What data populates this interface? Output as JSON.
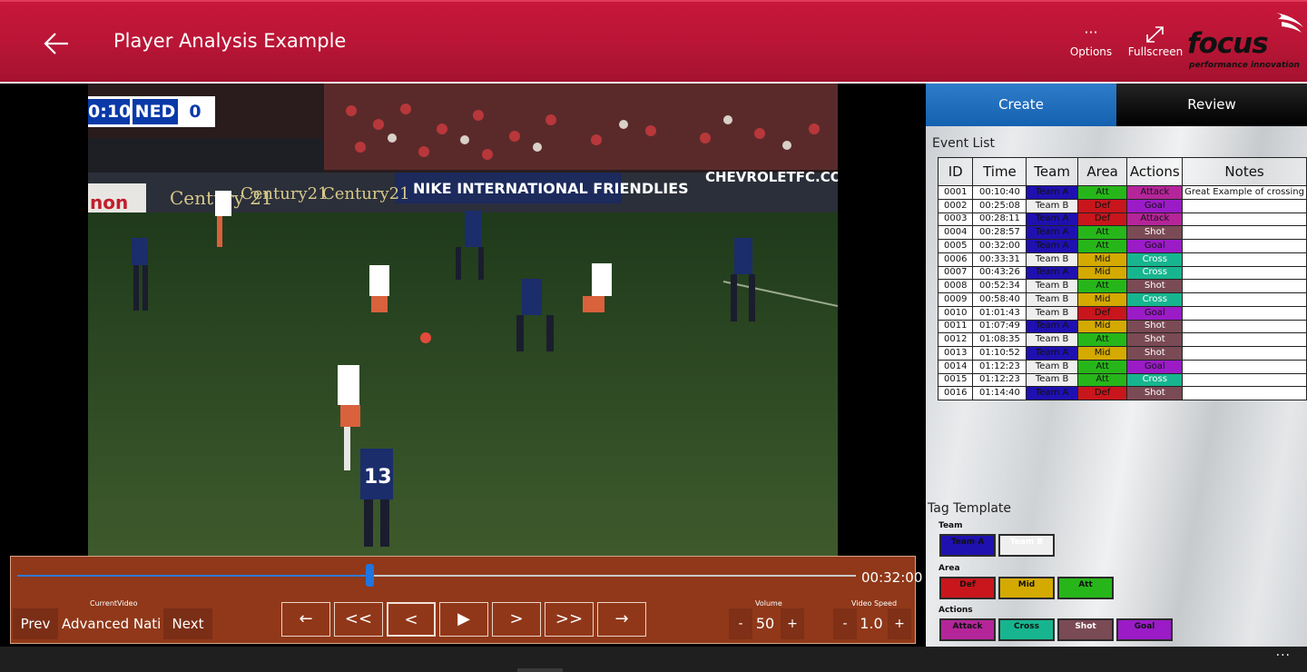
{
  "header": {
    "title": "Player Analysis Example",
    "back_icon": "back-arrow-icon",
    "options_label": "Options",
    "fullscreen_label": "Fullscreen",
    "logo_name": "focus",
    "logo_tagline": "performance innovation",
    "brand_color": "#b81535"
  },
  "video": {
    "scoreboard": {
      "clock": "0:10",
      "team": "NED",
      "score": "0"
    },
    "current_time": "00:32:00",
    "progress": 0.42,
    "current_video_label": "CurrentVideo",
    "current_video_name": "Advanced National",
    "prev_label": "Prev",
    "next_label": "Next",
    "transport": [
      {
        "name": "jump-back",
        "glyph": "←"
      },
      {
        "name": "fast-rewind",
        "glyph": "<<"
      },
      {
        "name": "step-back",
        "glyph": "<"
      },
      {
        "name": "play",
        "glyph": "▶"
      },
      {
        "name": "step-forward",
        "glyph": ">"
      },
      {
        "name": "fast-forward",
        "glyph": ">>"
      },
      {
        "name": "jump-forward",
        "glyph": "→"
      }
    ],
    "volume_label": "Volume",
    "volume_value": "50",
    "speed_label": "Video Speed",
    "speed_value": "1.0",
    "minus": "-",
    "plus": "+"
  },
  "panel": {
    "tabs": [
      {
        "label": "Create"
      },
      {
        "label": "Review"
      }
    ],
    "event_list_label": "Event List",
    "columns": [
      "ID",
      "Time",
      "Team",
      "Area",
      "Actions",
      "Notes"
    ],
    "events": [
      {
        "id": "0001",
        "time": "00:10:40",
        "team": "Team A",
        "area": "Att",
        "action": "Attack",
        "notes": "Great Example of crossing"
      },
      {
        "id": "0002",
        "time": "00:25:08",
        "team": "Team B",
        "area": "Def",
        "action": "Goal",
        "notes": ""
      },
      {
        "id": "0003",
        "time": "00:28:11",
        "team": "Team A",
        "area": "Def",
        "action": "Attack",
        "notes": ""
      },
      {
        "id": "0004",
        "time": "00:28:57",
        "team": "Team A",
        "area": "Att",
        "action": "Shot",
        "notes": ""
      },
      {
        "id": "0005",
        "time": "00:32:00",
        "team": "Team A",
        "area": "Att",
        "action": "Goal",
        "notes": ""
      },
      {
        "id": "0006",
        "time": "00:33:31",
        "team": "Team B",
        "area": "Mid",
        "action": "Cross",
        "notes": ""
      },
      {
        "id": "0007",
        "time": "00:43:26",
        "team": "Team A",
        "area": "Mid",
        "action": "Cross",
        "notes": ""
      },
      {
        "id": "0008",
        "time": "00:52:34",
        "team": "Team B",
        "area": "Att",
        "action": "Shot",
        "notes": ""
      },
      {
        "id": "0009",
        "time": "00:58:40",
        "team": "Team B",
        "area": "Mid",
        "action": "Cross",
        "notes": ""
      },
      {
        "id": "0010",
        "time": "01:01:43",
        "team": "Team B",
        "area": "Def",
        "action": "Goal",
        "notes": ""
      },
      {
        "id": "0011",
        "time": "01:07:49",
        "team": "Team A",
        "area": "Mid",
        "action": "Shot",
        "notes": ""
      },
      {
        "id": "0012",
        "time": "01:08:35",
        "team": "Team B",
        "area": "Att",
        "action": "Shot",
        "notes": ""
      },
      {
        "id": "0013",
        "time": "01:10:52",
        "team": "Team A",
        "area": "Mid",
        "action": "Shot",
        "notes": ""
      },
      {
        "id": "0014",
        "time": "01:12:23",
        "team": "Team B",
        "area": "Att",
        "action": "Goal",
        "notes": ""
      },
      {
        "id": "0015",
        "time": "01:12:23",
        "team": "Team B",
        "area": "Att",
        "action": "Cross",
        "notes": ""
      },
      {
        "id": "0016",
        "time": "01:14:40",
        "team": "Team A",
        "area": "Def",
        "action": "Shot",
        "notes": ""
      }
    ],
    "tag_template_label": "Tag Template",
    "tag_groups": {
      "team_heading": "Team",
      "team": [
        "Team A",
        "Team B"
      ],
      "area_heading": "Area",
      "area": [
        "Def",
        "Mid",
        "Att"
      ],
      "actions_heading": "Actions",
      "actions": [
        "Attack",
        "Cross",
        "Shot",
        "Goal"
      ]
    },
    "colors": {
      "Team A": "#1f10b0",
      "Team B": "#efefef",
      "Def": "#c8161c",
      "Mid": "#d4aa00",
      "Att": "#27b619",
      "Attack": "#b5259a",
      "Cross": "#17b58f",
      "Shot": "#7a4a55",
      "Goal": "#9b1bc7"
    }
  },
  "bottom_bar": {
    "more": "···"
  }
}
